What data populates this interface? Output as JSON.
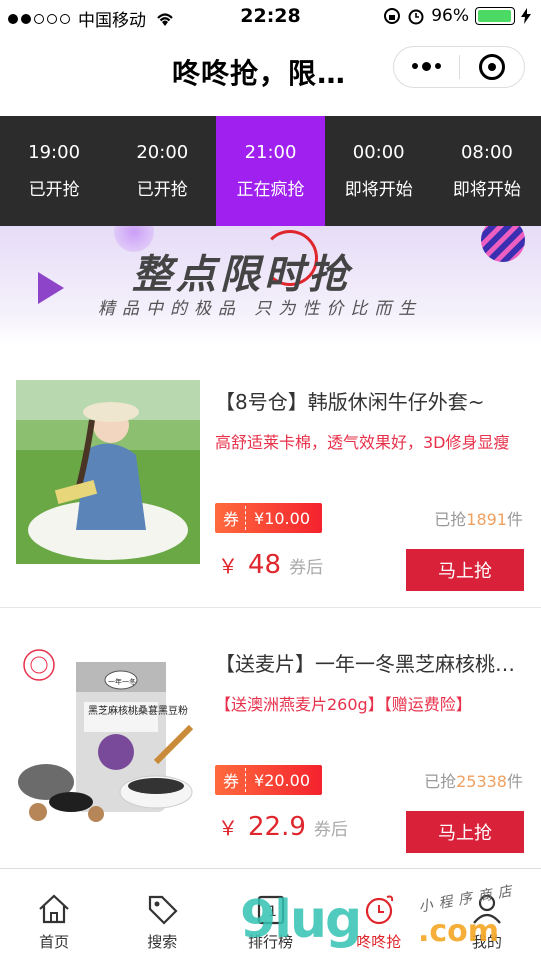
{
  "status_bar": {
    "carrier": "中国移动",
    "time": "22:28",
    "battery_percent": "96%",
    "battery_level": 0.96
  },
  "header": {
    "title": "咚咚抢，限…"
  },
  "time_tabs": [
    {
      "time": "19:00",
      "status": "已开抢",
      "active": false
    },
    {
      "time": "20:00",
      "status": "已开抢",
      "active": false
    },
    {
      "time": "21:00",
      "status": "正在疯抢",
      "active": true
    },
    {
      "time": "00:00",
      "status": "即将开始",
      "active": false
    },
    {
      "time": "08:00",
      "status": "即将开始",
      "active": false
    }
  ],
  "banner": {
    "title": "整点限时抢",
    "subtitle": "精品中的极品 只为性价比而生"
  },
  "products": [
    {
      "name": "【8号仓】韩版休闲牛仔外套~",
      "description": "高舒适莱卡棉，透气效果好，3D修身显瘦",
      "coupon_label": "券",
      "coupon_value": "¥10.00",
      "grabbed_prefix": "已抢",
      "grabbed_count": "1891",
      "grabbed_suffix": "件",
      "price_symbol": "￥",
      "price": "48",
      "price_suffix": "券后",
      "buy_label": "马上抢"
    },
    {
      "name": "【送麦片】一年一冬黑芝麻核桃…",
      "description": "【送澳洲燕麦片260g】【赠运费险】",
      "coupon_label": "券",
      "coupon_value": "¥20.00",
      "grabbed_prefix": "已抢",
      "grabbed_count": "25338",
      "grabbed_suffix": "件",
      "price_symbol": "￥",
      "price": "22.9",
      "price_suffix": "券后",
      "buy_label": "马上抢",
      "package_text": "黑芝麻核桃桑葚黑豆粉",
      "package_brand": "一年一冬"
    }
  ],
  "tab_bar": [
    {
      "label": "首页",
      "icon": "home-icon",
      "active": false
    },
    {
      "label": "搜索",
      "icon": "tag-icon",
      "active": false
    },
    {
      "label": "排行榜",
      "icon": "ranking-icon",
      "active": false
    },
    {
      "label": "咚咚抢",
      "icon": "flash-sale-icon",
      "active": true
    },
    {
      "label": "我的",
      "icon": "user-icon",
      "active": false
    }
  ],
  "watermark": {
    "main": "9lug",
    "suffix": ".com",
    "small": "小程序商店"
  },
  "colors": {
    "active_tab": "#a020f0",
    "price_red": "#e0262d",
    "buy_button": "#d9223a",
    "timetab_bg": "#2c2c2c"
  }
}
